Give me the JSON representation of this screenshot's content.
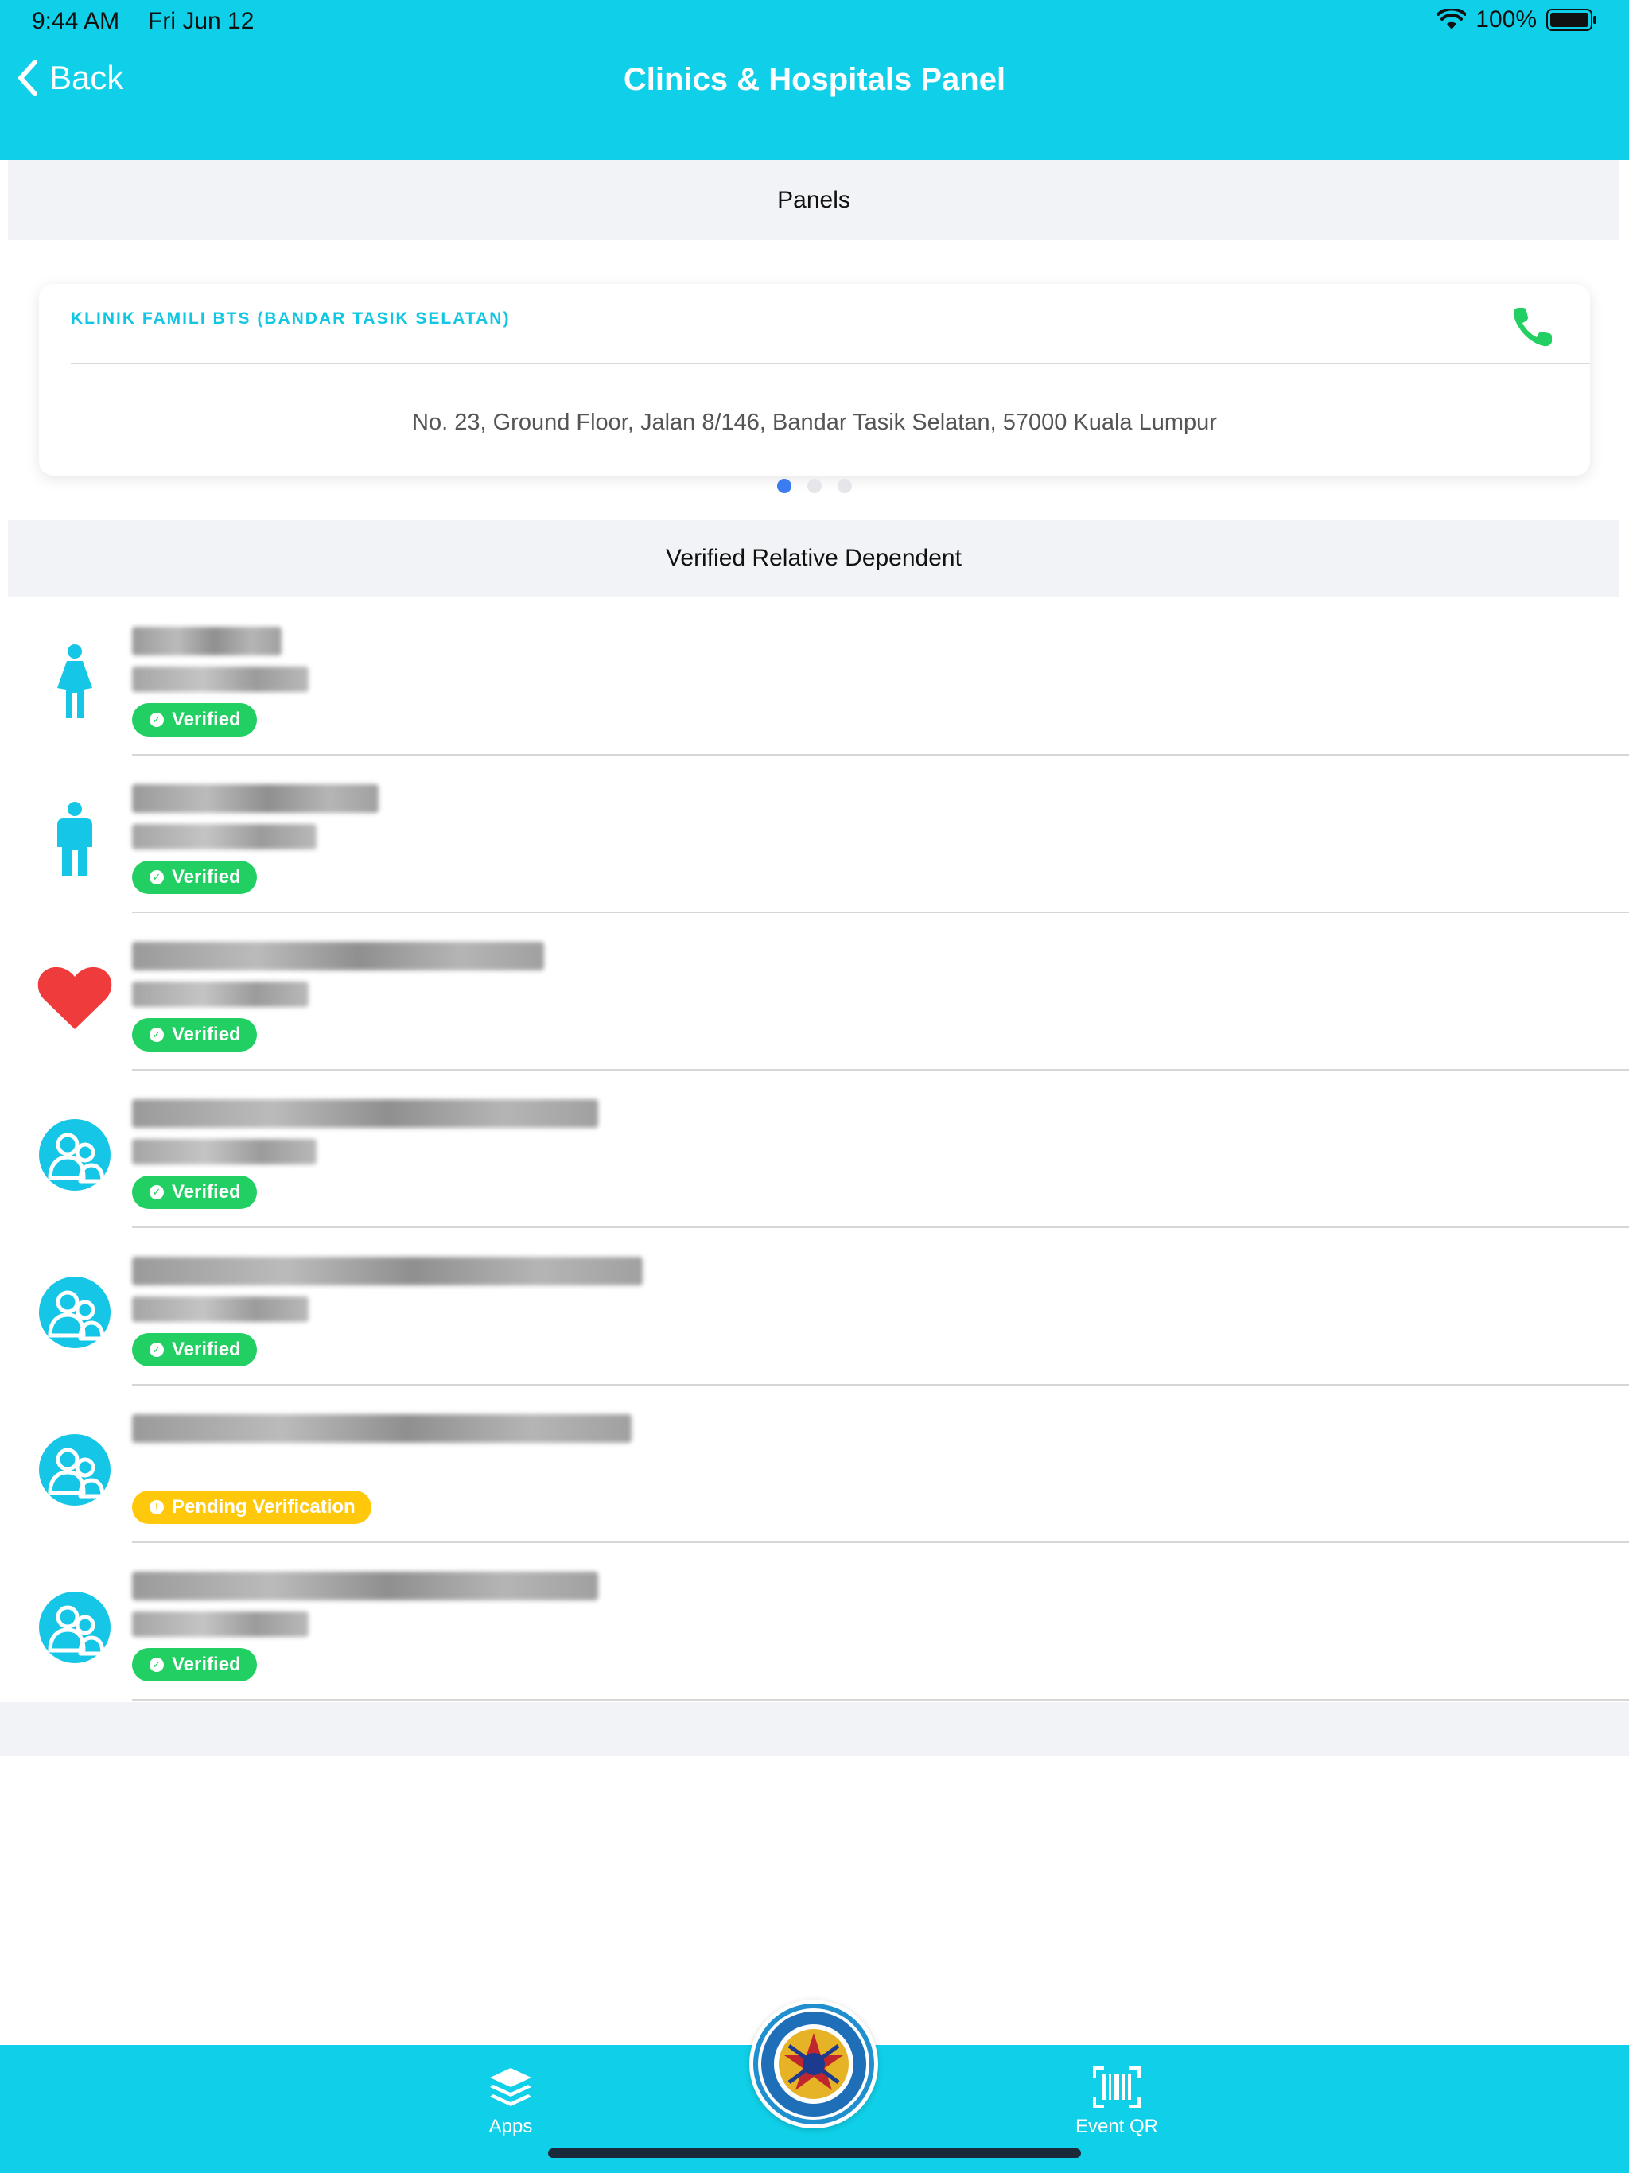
{
  "status_bar": {
    "time": "9:44 AM",
    "date": "Fri Jun 12",
    "battery": "100%"
  },
  "nav": {
    "back_label": "Back",
    "title": "Clinics & Hospitals Panel"
  },
  "sections": {
    "panels": "Panels",
    "dependents": "Verified Relative Dependent"
  },
  "panel_card": {
    "clinic_name": "KLINIK FAMILI BTS (BANDAR TASIK SELATAN)",
    "address": "No. 23, Ground Floor, Jalan 8/146, Bandar Tasik Selatan, 57000 Kuala Lumpur",
    "page_count": 3,
    "active_page": 1
  },
  "dependents": [
    {
      "icon": "female-icon",
      "status": "Verified"
    },
    {
      "icon": "male-icon",
      "status": "Verified"
    },
    {
      "icon": "heart-icon",
      "status": "Verified"
    },
    {
      "icon": "family-icon",
      "status": "Verified"
    },
    {
      "icon": "family-icon",
      "status": "Verified"
    },
    {
      "icon": "family-icon",
      "status": "Pending Verification"
    },
    {
      "icon": "family-icon",
      "status": "Verified"
    }
  ],
  "tabbar": {
    "apps_label": "Apps",
    "event_qr_label": "Event QR"
  },
  "colors": {
    "accent": "#0fd0e8",
    "verified": "#22cf63",
    "pending": "#ffc80a",
    "heart": "#ef3b3b",
    "pager_active": "#3b7cf0"
  }
}
